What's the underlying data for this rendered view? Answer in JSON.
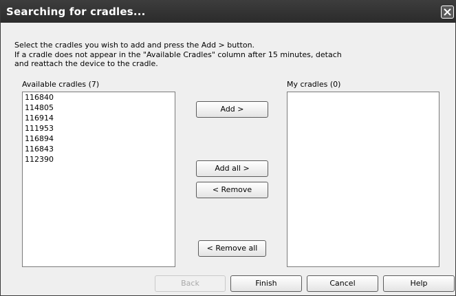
{
  "window": {
    "title": "Searching for cradles..."
  },
  "instructions": {
    "line1": "Select the cradles you wish to add and press the Add > button.",
    "line2": "If a cradle does not appear in the \"Available Cradles\" column after 15 minutes, detach",
    "line3": "and reattach the device to the cradle."
  },
  "available": {
    "label": "Available cradles (7)",
    "items": [
      "116840",
      "114805",
      "116914",
      "111953",
      "116894",
      "116843",
      "112390"
    ]
  },
  "mine": {
    "label": "My cradles (0)",
    "items": []
  },
  "buttons": {
    "add": "Add >",
    "add_all": "Add all >",
    "remove": "< Remove",
    "remove_all": "< Remove all",
    "back": "Back",
    "finish": "Finish",
    "cancel": "Cancel",
    "help": "Help"
  },
  "icons": {
    "close": "close-icon"
  }
}
